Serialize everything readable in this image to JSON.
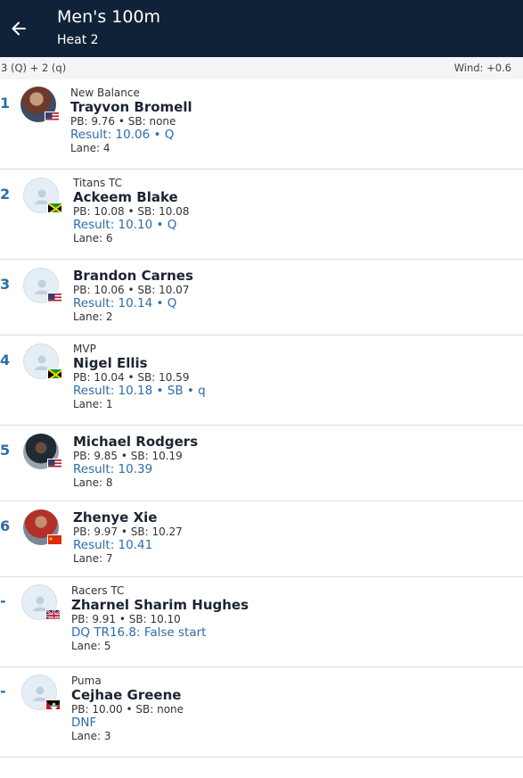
{
  "header": {
    "title": "Men's 100m",
    "subtitle": "Heat 2"
  },
  "info": {
    "qualification": "3 (Q) + 2 (q)",
    "wind": "Wind: +0.6"
  },
  "athletes": [
    {
      "rank": "1",
      "club": "New Balance",
      "name": "Trayvon Bromell",
      "pb_sb": "PB: 9.76 • SB: none",
      "result": "Result: 10.06 • Q",
      "lane": "Lane: 4",
      "country": "USA"
    },
    {
      "rank": "2",
      "club": "Titans TC",
      "name": "Ackeem Blake",
      "pb_sb": "PB: 10.08 • SB: 10.08",
      "result": "Result: 10.10 • Q",
      "lane": "Lane: 6",
      "country": "JAM"
    },
    {
      "rank": "3",
      "club": "",
      "name": "Brandon Carnes",
      "pb_sb": "PB: 10.06 • SB: 10.07",
      "result": "Result: 10.14 • Q",
      "lane": "Lane: 2",
      "country": "USA"
    },
    {
      "rank": "4",
      "club": "MVP",
      "name": "Nigel Ellis",
      "pb_sb": "PB: 10.04 • SB: 10.59",
      "result": "Result: 10.18 • SB • q",
      "lane": "Lane: 1",
      "country": "JAM"
    },
    {
      "rank": "5",
      "club": "",
      "name": "Michael Rodgers",
      "pb_sb": "PB: 9.85 • SB: 10.19",
      "result": "Result: 10.39",
      "lane": "Lane: 8",
      "country": "USA"
    },
    {
      "rank": "6",
      "club": "",
      "name": "Zhenye Xie",
      "pb_sb": "PB: 9.97 • SB: 10.27",
      "result": "Result: 10.41",
      "lane": "Lane: 7",
      "country": "CHN"
    },
    {
      "rank": "-",
      "club": "Racers TC",
      "name": "Zharnel Sharim Hughes",
      "pb_sb": "PB: 9.91 • SB: 10.10",
      "result": "DQ TR16.8: False start",
      "lane": "Lane: 5",
      "country": "GBR"
    },
    {
      "rank": "-",
      "club": "Puma",
      "name": "Cejhae Greene",
      "pb_sb": "PB: 10.00 • SB: none",
      "result": "DNF",
      "lane": "Lane: 3",
      "country": "ANT"
    }
  ]
}
